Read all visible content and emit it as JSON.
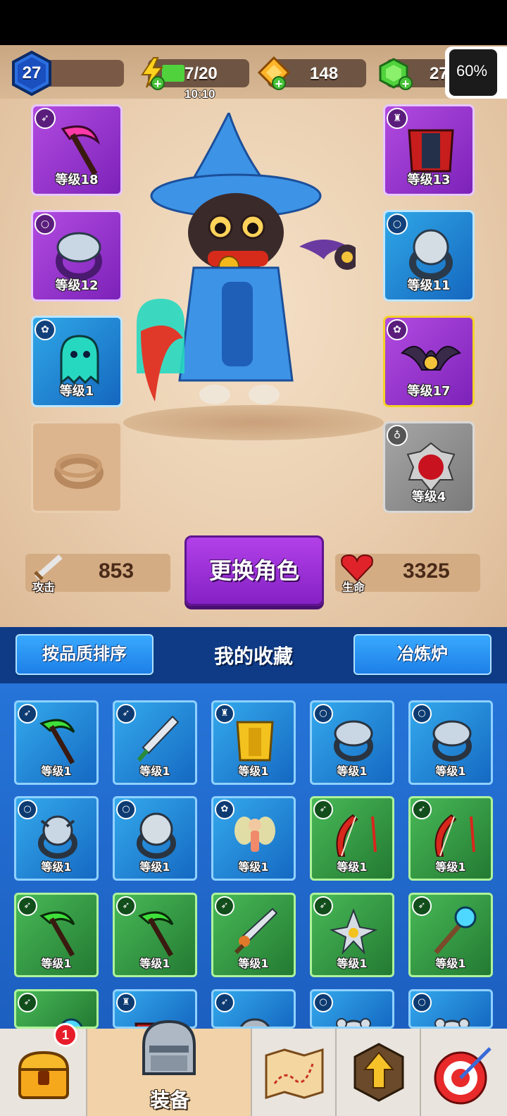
{
  "header": {
    "player_level": "27",
    "energy": "7/20",
    "energy_timer": "10:10",
    "coins": "148",
    "gems": "27",
    "overlay_percent": "60%"
  },
  "equipment": {
    "left": [
      {
        "label": "等级18",
        "type_icon": "bow-icon",
        "item": "pink-scythe",
        "rarity": "purple"
      },
      {
        "label": "等级12",
        "type_icon": "ring-icon",
        "item": "serpent-ring",
        "rarity": "purple"
      },
      {
        "label": "等级1",
        "type_icon": "paw-icon",
        "item": "ghost-pet",
        "rarity": "blue"
      },
      {
        "label": "",
        "type_icon": "ring-icon",
        "item": "empty-ring-slot",
        "rarity": "empty"
      }
    ],
    "right": [
      {
        "label": "等级13",
        "type_icon": "armor-icon",
        "item": "red-cape",
        "rarity": "purple"
      },
      {
        "label": "等级11",
        "type_icon": "ring-icon",
        "item": "lion-ring",
        "rarity": "blue"
      },
      {
        "label": "等级17",
        "type_icon": "paw-icon",
        "item": "bat-pet",
        "rarity": "gold"
      },
      {
        "label": "等级4",
        "type_icon": "necklace-icon",
        "item": "ruby-amulet",
        "rarity": "grey"
      }
    ]
  },
  "stats": {
    "attack_label": "攻击",
    "attack_value": "853",
    "hp_label": "生命",
    "hp_value": "3325"
  },
  "change_character_label": "更换角色",
  "collection": {
    "sort_button": "按品质排序",
    "title": "我的收藏",
    "smelter_button": "冶炼炉",
    "items": [
      {
        "label": "等级1",
        "type_icon": "bow-icon",
        "item": "green-scythe",
        "rarity": "blue"
      },
      {
        "label": "等级1",
        "type_icon": "bow-icon",
        "item": "dagger",
        "rarity": "blue"
      },
      {
        "label": "等级1",
        "type_icon": "armor-icon",
        "item": "gold-armor",
        "rarity": "blue"
      },
      {
        "label": "等级1",
        "type_icon": "ring-icon",
        "item": "serpent-ring",
        "rarity": "blue"
      },
      {
        "label": "等级1",
        "type_icon": "ring-icon",
        "item": "serpent-ring",
        "rarity": "blue"
      },
      {
        "label": "等级1",
        "type_icon": "ring-icon",
        "item": "bull-ring",
        "rarity": "blue"
      },
      {
        "label": "等级1",
        "type_icon": "ring-icon",
        "item": "lion-ring",
        "rarity": "blue"
      },
      {
        "label": "等级1",
        "type_icon": "paw-icon",
        "item": "fairy-pet",
        "rarity": "blue"
      },
      {
        "label": "等级1",
        "type_icon": "bow-icon",
        "item": "red-bow",
        "rarity": "green"
      },
      {
        "label": "等级1",
        "type_icon": "bow-icon",
        "item": "red-bow",
        "rarity": "green"
      },
      {
        "label": "等级1",
        "type_icon": "bow-icon",
        "item": "green-scythe",
        "rarity": "green"
      },
      {
        "label": "等级1",
        "type_icon": "bow-icon",
        "item": "green-scythe",
        "rarity": "green"
      },
      {
        "label": "等级1",
        "type_icon": "bow-icon",
        "item": "serrated-sword",
        "rarity": "green"
      },
      {
        "label": "等级1",
        "type_icon": "bow-icon",
        "item": "shuriken",
        "rarity": "green"
      },
      {
        "label": "等级1",
        "type_icon": "bow-icon",
        "item": "magic-staff",
        "rarity": "green"
      },
      {
        "label": "",
        "type_icon": "bow-icon",
        "item": "staff-partial",
        "rarity": "green"
      },
      {
        "label": "",
        "type_icon": "armor-icon",
        "item": "cape-partial",
        "rarity": "blue"
      },
      {
        "label": "",
        "type_icon": "bow-icon",
        "item": "helmet-partial",
        "rarity": "blue"
      },
      {
        "label": "",
        "type_icon": "ring-icon",
        "item": "bear-ring-partial",
        "rarity": "blue"
      },
      {
        "label": "",
        "type_icon": "ring-icon",
        "item": "bear-ring-partial",
        "rarity": "blue"
      }
    ]
  },
  "bottom_nav": {
    "items": [
      {
        "name": "shop",
        "icon": "treasure-chest-icon",
        "badge": "1"
      },
      {
        "name": "equipment",
        "icon": "armor-helmet-icon",
        "label": "装备",
        "active": true
      },
      {
        "name": "map",
        "icon": "map-icon"
      },
      {
        "name": "upgrade",
        "icon": "arrow-up-icon"
      },
      {
        "name": "challenge",
        "icon": "target-icon"
      }
    ]
  },
  "colors": {
    "purple": "#9b34cf",
    "blue": "#1f84d6",
    "green": "#2f9a3f",
    "gold_border": "#f4d22a",
    "energy_green": "#4fd23c"
  }
}
